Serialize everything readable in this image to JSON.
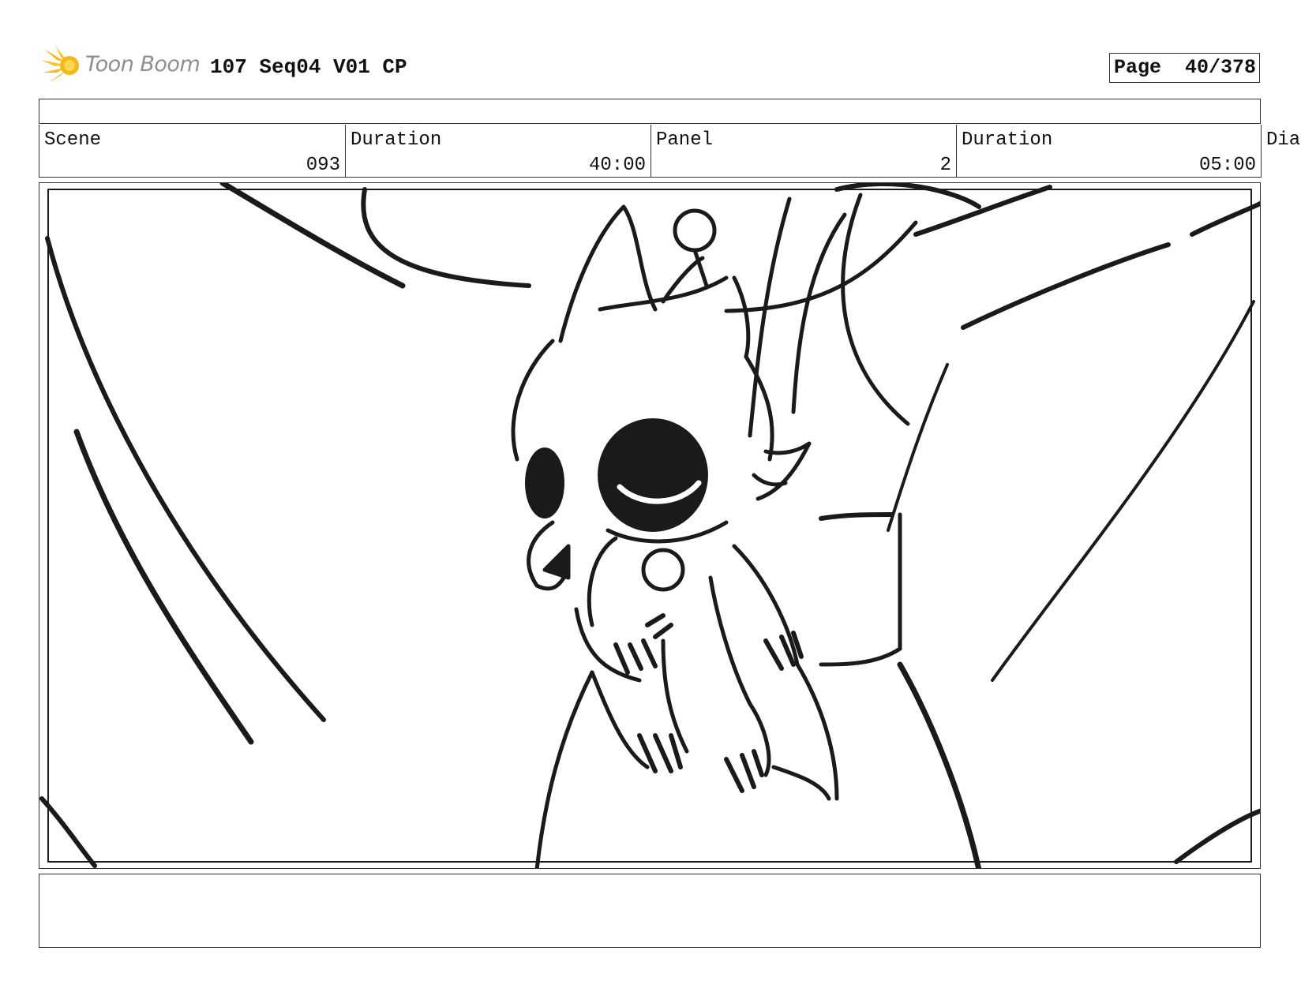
{
  "header": {
    "logo_text": "Toon Boom",
    "project_title": "107 Seq04 V01 CP",
    "page_label": "Page",
    "page_number": "40/378"
  },
  "fields": [
    {
      "label": "Scene",
      "value": "093"
    },
    {
      "label": "Duration",
      "value": "40:00"
    },
    {
      "label": "Panel",
      "value": "2"
    },
    {
      "label": "Duration",
      "value": "05:00"
    }
  ],
  "overflow_label": "Dia",
  "panel": {
    "image_description": "storyboard sketch of small creature held in large hand"
  },
  "notes": {
    "text": ""
  },
  "colors": {
    "logo_accent": "#f5b915",
    "border": "#333333",
    "ink": "#1a1a1a"
  }
}
